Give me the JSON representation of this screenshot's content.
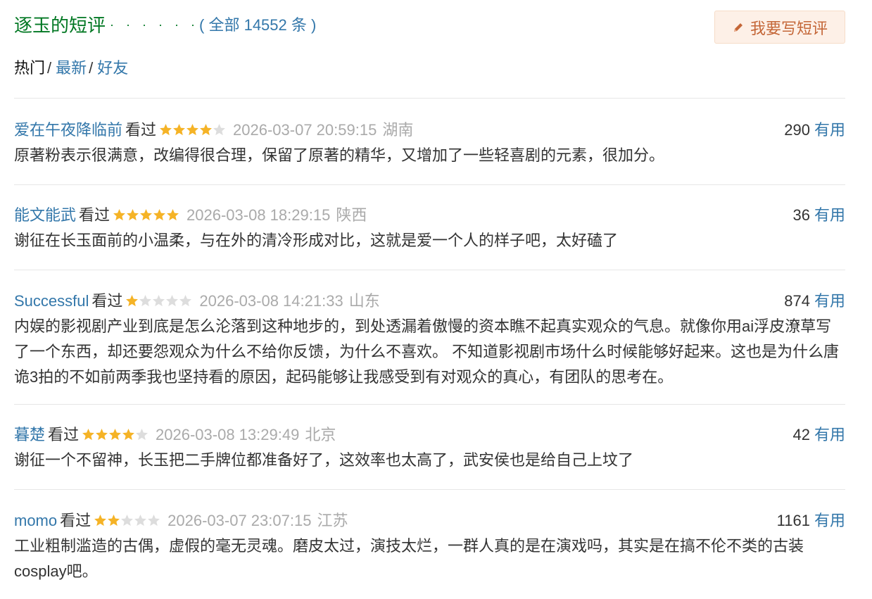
{
  "header": {
    "title": "逐玉的短评",
    "dots": "· · · · · ·",
    "count_prefix": "( 全部",
    "count": "14552",
    "count_suffix": "条 )",
    "write_button_label": "我要写短评",
    "write_icon": "pencil-icon"
  },
  "tabs": {
    "hot": "热门",
    "sep1": "/",
    "latest": "最新",
    "sep2": "/",
    "friends": "好友"
  },
  "comments": [
    {
      "author": "爱在午夜降临前",
      "status": "看过",
      "rating": 4,
      "time": "2026-03-07 20:59:15",
      "location": "湖南",
      "votes": "290",
      "useful": "有用",
      "text": "原著粉表示很满意，改编得很合理，保留了原著的精华，又增加了一些轻喜剧的元素，很加分。"
    },
    {
      "author": "能文能武",
      "status": "看过",
      "rating": 5,
      "time": "2026-03-08 18:29:15",
      "location": "陕西",
      "votes": "36",
      "useful": "有用",
      "text": "谢征在长玉面前的小温柔，与在外的清冷形成对比，这就是爱一个人的样子吧，太好磕了"
    },
    {
      "author": "Successful",
      "status": "看过",
      "rating": 1,
      "time": "2026-03-08 14:21:33",
      "location": "山东",
      "votes": "874",
      "useful": "有用",
      "text": "内娱的影视剧产业到底是怎么沦落到这种地步的，到处透漏着傲慢的资本瞧不起真实观众的气息。就像你用ai浮皮潦草写了一个东西，却还要怨观众为什么不给你反馈，为什么不喜欢。 不知道影视剧市场什么时候能够好起来。这也是为什么唐诡3拍的不如前两季我也坚持看的原因，起码能够让我感受到有对观众的真心，有团队的思考在。"
    },
    {
      "author": "暮楚",
      "status": "看过",
      "rating": 4,
      "time": "2026-03-08 13:29:49",
      "location": "北京",
      "votes": "42",
      "useful": "有用",
      "text": "谢征一个不留神，长玉把二手牌位都准备好了，这效率也太高了，武安侯也是给自己上坟了"
    },
    {
      "author": "momo",
      "status": "看过",
      "rating": 2,
      "time": "2026-03-07 23:07:15",
      "location": "江苏",
      "votes": "1161",
      "useful": "有用",
      "text": "工业粗制滥造的古偶，虚假的毫无灵魂。磨皮太过，演技太烂，一群人真的是在演戏吗，其实是在搞不伦不类的古装cosplay吧。"
    }
  ],
  "colors": {
    "title_green": "#007722",
    "link_blue": "#3377aa",
    "star_gold": "#f5b326",
    "star_empty": "#dddddd",
    "muted_gray": "#aaaaaa",
    "button_bg": "#fdf0e7",
    "button_text": "#c46637"
  }
}
